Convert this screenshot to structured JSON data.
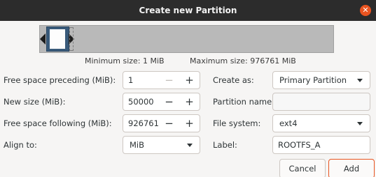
{
  "window": {
    "title": "Create new Partition",
    "close_glyph": "✕"
  },
  "sizes": {
    "minimum": "Minimum size: 1 MiB",
    "maximum": "Maximum size: 976761 MiB"
  },
  "fields": {
    "free_preceding": {
      "label": "Free space preceding (MiB):",
      "value": "1"
    },
    "new_size": {
      "label": "New size (MiB):",
      "value": "50000"
    },
    "free_following": {
      "label": "Free space following (MiB):",
      "value": "926761"
    },
    "align_to": {
      "label": "Align to:",
      "value": "MiB"
    },
    "create_as": {
      "label": "Create as:",
      "value": "Primary Partition"
    },
    "partition_name": {
      "label": "Partition name:",
      "value": ""
    },
    "file_system": {
      "label": "File system:",
      "value": "ext4"
    },
    "label": {
      "label": "Label:",
      "value": "ROOTFS_A"
    }
  },
  "spin": {
    "minus": "−",
    "plus": "+"
  },
  "buttons": {
    "cancel": "Cancel",
    "add": "Add"
  },
  "colors": {
    "accent": "#e95420",
    "partition": "#395a7a",
    "titlebar": "#2c2c2c"
  }
}
